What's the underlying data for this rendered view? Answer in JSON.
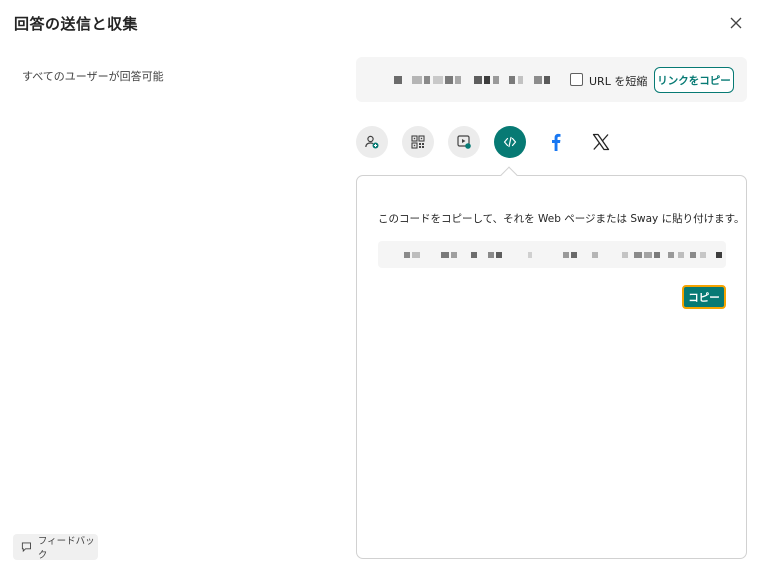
{
  "dialog": {
    "title": "回答の送信と収集",
    "close_icon": "close-icon"
  },
  "audience": {
    "label": "すべてのユーザーが回答可能"
  },
  "link_bar": {
    "shorten_label": "URL を短縮",
    "shorten_checked": false,
    "copy_link_label": "リンクをコピー"
  },
  "share_options": [
    {
      "name": "invite-people",
      "icon": "person-add-icon",
      "active": false
    },
    {
      "name": "qr-code",
      "icon": "qr-code-icon",
      "active": false
    },
    {
      "name": "present",
      "icon": "present-icon",
      "active": false
    },
    {
      "name": "embed",
      "icon": "code-icon",
      "active": true
    },
    {
      "name": "facebook",
      "icon": "facebook-icon",
      "active": false
    },
    {
      "name": "x",
      "icon": "x-logo-icon",
      "active": false
    }
  ],
  "embed_panel": {
    "instruction": "このコードをコピーして、それを Web ページまたは Sway に貼り付けます。",
    "copy_label": "コピー"
  },
  "feedback": {
    "label": "フィードバック"
  },
  "colors": {
    "accent": "#077a74",
    "focus_ring": "#f5a300",
    "surface": "#f5f5f5"
  }
}
